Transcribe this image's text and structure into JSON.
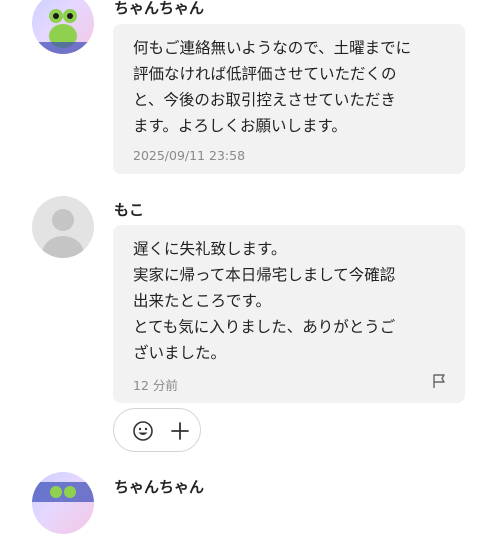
{
  "messages": [
    {
      "author": "ちゃんちゃん",
      "lines": [
        "何もご連絡無いようなので、土曜までに",
        "評価なければ低評価させていただくの",
        "と、今後のお取引控えさせていただき",
        "ます。よろしくお願いします。"
      ],
      "timestamp": "2025/09/11 23:58"
    },
    {
      "author": "もこ",
      "lines": [
        "遅くに失礼致します。",
        "実家に帰って本日帰宅しまして今確認",
        "出来たところです。",
        "とても気に入りました、ありがとうご",
        "ざいました。"
      ],
      "timestamp": "12 分前"
    },
    {
      "author": "ちゃんちゃん"
    }
  ],
  "icons": {
    "report": "flag-icon",
    "emoji": "smiley-icon",
    "add": "plus-icon"
  },
  "colors": {
    "bubble": "#f2f2f2",
    "meta_text": "#8a8a8a",
    "avatar_placeholder": "#e3e3e3"
  }
}
